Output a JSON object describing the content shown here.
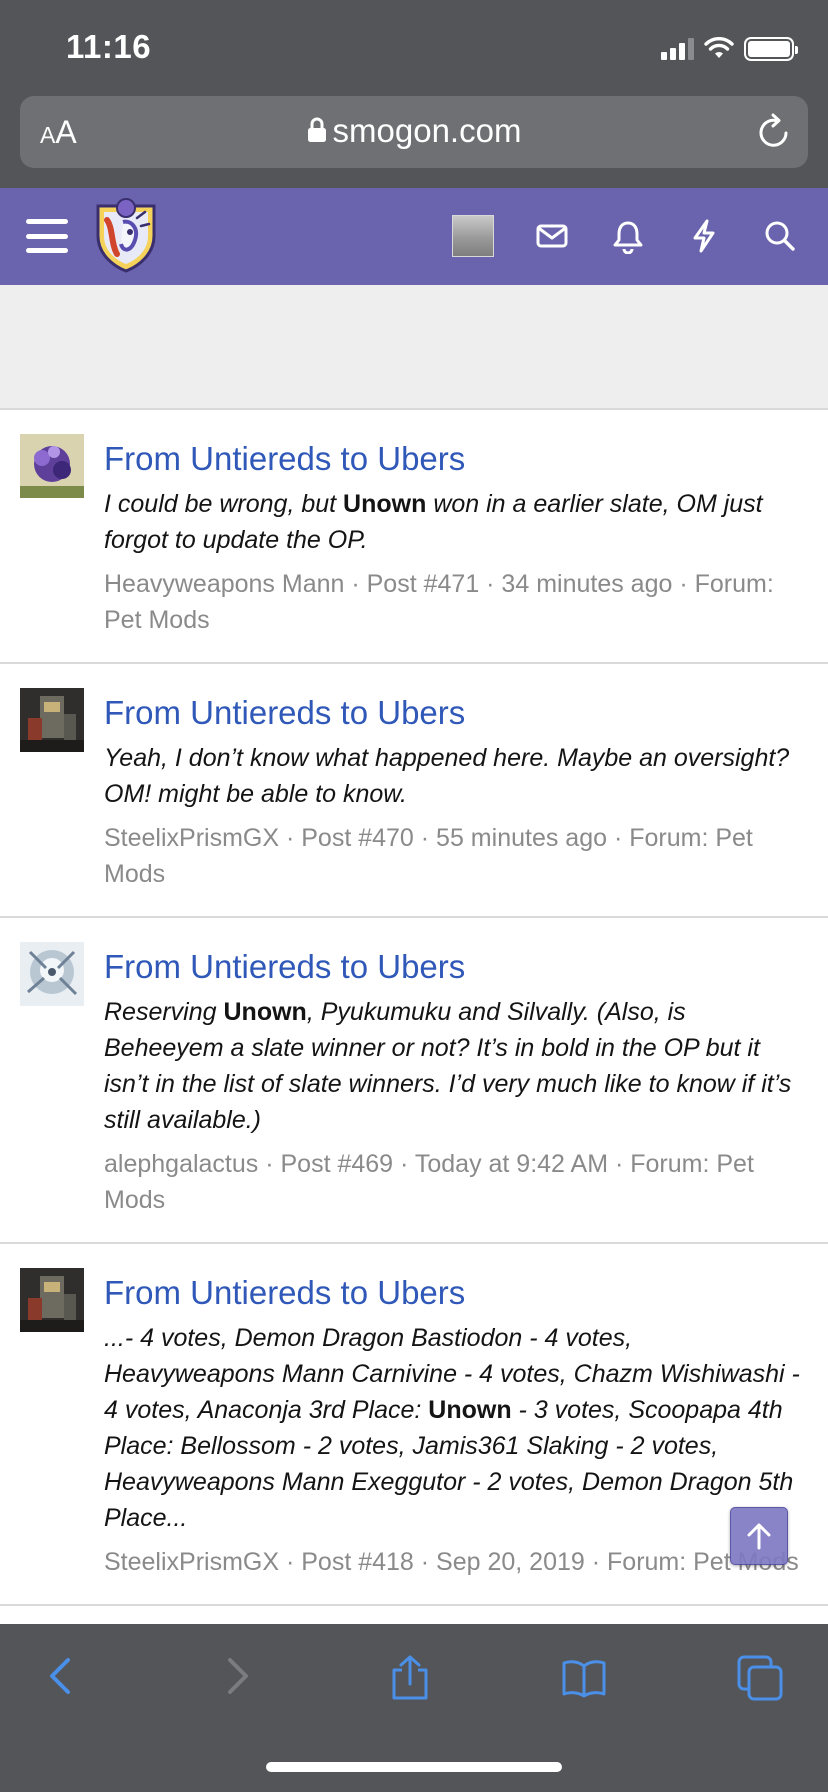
{
  "status_bar": {
    "time": "11:16"
  },
  "address_bar": {
    "text_size_label": "AA",
    "domain": "smogon.com"
  },
  "site_nav": {
    "icons": [
      "menu-icon",
      "site-logo",
      "user-avatar",
      "mail-icon",
      "bell-icon",
      "bolt-icon",
      "search-icon"
    ]
  },
  "results": [
    {
      "title": "From Untiereds to Ubers",
      "snippet_before": "I could be wrong, but ",
      "snippet_bold": "Unown",
      "snippet_after": " won in a earlier slate, OM just forgot to update the OP.",
      "meta": "Heavyweapons Mann · Post #471 · 34 minutes ago · Forum: Pet Mods"
    },
    {
      "title": "From Untiereds to Ubers",
      "snippet_before": "Yeah, I don’t know what happened here. Maybe an oversight? OM! might be able to know.",
      "snippet_bold": "",
      "snippet_after": "",
      "meta": "SteelixPrismGX · Post #470 · 55 minutes ago · Forum: Pet Mods"
    },
    {
      "title": "From Untiereds to Ubers",
      "snippet_before": "Reserving ",
      "snippet_bold": "Unown",
      "snippet_after": ", Pyukumuku and Silvally. (Also, is Beheeyem a slate winner or not? It’s in bold in the OP but it isn’t in the list of slate winners. I’d very much like to know if it’s still available.)",
      "meta": "alephgalactus · Post #469 · Today at 9:42 AM · Forum: Pet Mods"
    },
    {
      "title": "From Untiereds to Ubers",
      "snippet_before": "...- 4 votes, Demon Dragon Bastiodon - 4 votes, Heavyweapons Mann Carnivine - 4 votes, Chazm Wishiwashi - 4 votes, Anaconja 3rd Place: ",
      "snippet_bold": "Unown",
      "snippet_after": " - 3 votes, Scoopapa 4th Place: Bellossom - 2 votes, Jamis361 Slaking - 2 votes, Heavyweapons Mann Exeggutor - 2 votes, Demon Dragon 5th Place...",
      "meta": "SteelixPrismGX · Post #418 · Sep 20, 2019 · Forum: Pet Mods"
    }
  ],
  "colors": {
    "browser_chrome": "#545558",
    "nav_bar": "#6a63ad",
    "link": "#2f58b8",
    "toolbar_icon": "#4a8fe8"
  }
}
